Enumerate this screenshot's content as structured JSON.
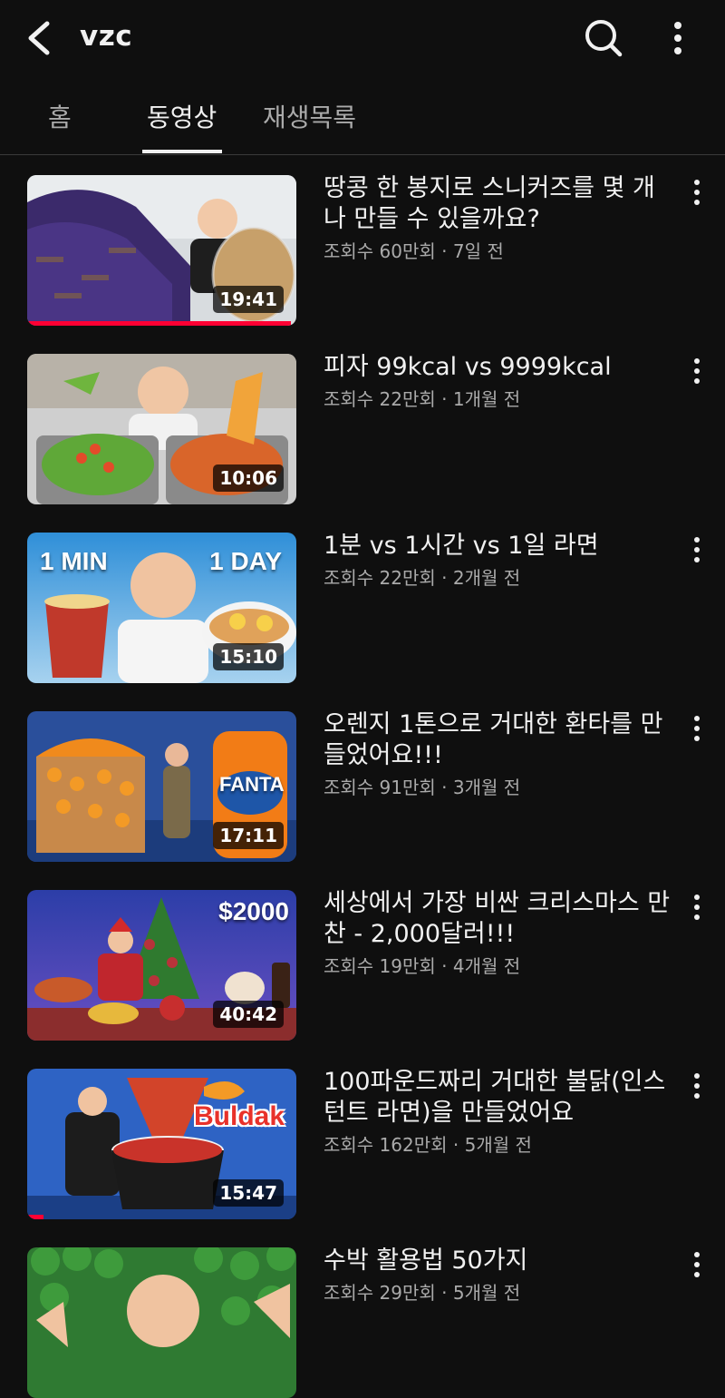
{
  "header": {
    "channel_name": "vzc",
    "back_icon": "back-arrow-icon",
    "search_icon": "search-icon",
    "more_icon": "more-vert-icon"
  },
  "tabs": [
    {
      "label": "홈",
      "active": false
    },
    {
      "label": "동영상",
      "active": true
    },
    {
      "label": "재생목록",
      "active": false
    }
  ],
  "videos": [
    {
      "title": "땅콩 한 봉지로 스니커즈를 몇 개나 만들 수 있을까요?",
      "meta": "조회수 60만회 · 7일 전",
      "duration": "19:41",
      "watched": 0.98,
      "overlay": ""
    },
    {
      "title": "피자 99kcal vs 9999kcal",
      "meta": "조회수 22만회 · 1개월 전",
      "duration": "10:06",
      "overlay": ""
    },
    {
      "title": "1분 vs 1시간 vs 1일 라면",
      "meta": "조회수 22만회 · 2개월 전",
      "duration": "15:10",
      "overlay_left": "1 MIN",
      "overlay_right": "1 DAY"
    },
    {
      "title": "오렌지 1톤으로 거대한 환타를 만들었어요!!!",
      "meta": "조회수 91만회 · 3개월 전",
      "duration": "17:11",
      "overlay": "FANTA"
    },
    {
      "title": "세상에서 가장 비싼 크리스마스 만찬 - 2,000달러!!!",
      "meta": "조회수 19만회 · 4개월 전",
      "duration": "40:42",
      "overlay": "$2000"
    },
    {
      "title": "100파운드짜리 거대한 불닭(인스턴트 라면)을 만들었어요",
      "meta": "조회수 162만회 · 5개월 전",
      "duration": "15:47",
      "watched": 0.06,
      "overlay": "Buldak"
    },
    {
      "title": "수박 활용법 50가지",
      "meta": "조회수 29만회 · 5개월 전",
      "duration": "",
      "overlay": ""
    }
  ],
  "colors": {
    "background": "#0f0f0f",
    "text": "#f1f1f1",
    "secondary": "#aaaaaa",
    "progress": "#ff0033"
  }
}
